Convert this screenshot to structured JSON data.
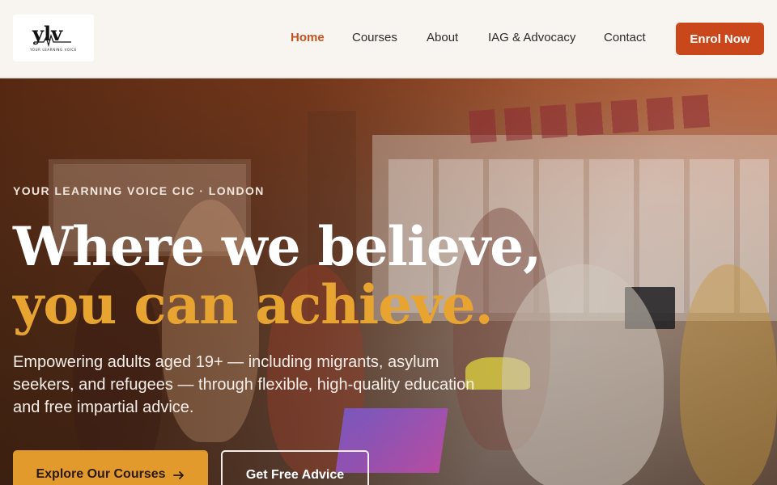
{
  "brand": {
    "logo_text": "YOUR LEARNING VOICE"
  },
  "nav": {
    "items": [
      {
        "label": "Home",
        "active": true
      },
      {
        "label": "Courses",
        "active": false
      },
      {
        "label": "About",
        "active": false
      },
      {
        "label": "IAG & Advocacy",
        "active": false
      },
      {
        "label": "Contact",
        "active": false
      }
    ],
    "cta_label": "Enrol Now"
  },
  "hero": {
    "eyebrow": "YOUR LEARNING VOICE CIC · LONDON",
    "headline_line1": "Where we believe,",
    "headline_line2": "you can achieve.",
    "lead": "Empowering adults aged 19+ — including migrants, asylum seekers, and refugees — through flexible, high-quality education and free impartial advice.",
    "primary_button": "Explore Our Courses",
    "primary_button_icon": "arrow-right-icon",
    "secondary_button": "Get Free Advice"
  },
  "colors": {
    "accent": "#c9471a",
    "active_nav": "#c4521f",
    "headline_highlight": "#e8a431",
    "primary_button": "#e39a2d"
  }
}
